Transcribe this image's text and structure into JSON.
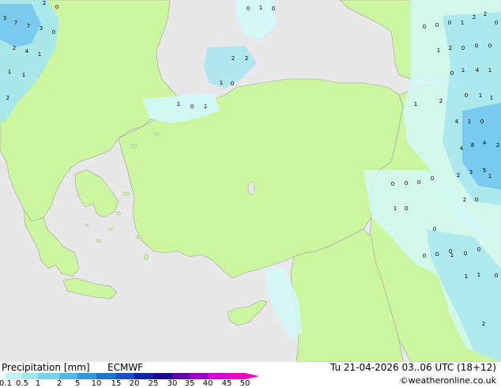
{
  "footer": {
    "title": "Precipitation [mm]",
    "model": "ECMWF",
    "valid_time": "Tu 21-04-2026 03..06 UTC (18+12)",
    "credit": "©weatheronline.co.uk"
  },
  "legend": {
    "ticks": [
      "0.1",
      "0.5",
      "1",
      "2",
      "5",
      "10",
      "15",
      "20",
      "25",
      "30",
      "35",
      "40",
      "45",
      "50"
    ],
    "colors": [
      "#e8fbfb",
      "#c4f4f4",
      "#a0e8ee",
      "#78d4ea",
      "#4fb8e4",
      "#2f98dc",
      "#1f72d0",
      "#1a4cc4",
      "#0f22a8",
      "#1a0a90",
      "#5a00b0",
      "#9a00c8",
      "#d800d8",
      "#f000c0"
    ]
  },
  "map_colors": {
    "sea": "#e8e8e8",
    "land": "#ccf5a0",
    "border": "#a0a0a0",
    "precip_light": "#d2f8f8",
    "precip_mid": "#a6e6f0",
    "precip_heavy": "#6ec4ee"
  },
  "precip_labels": [
    {
      "text": "3"
    },
    {
      "text": "7"
    },
    {
      "text": "7"
    },
    {
      "text": "3"
    },
    {
      "text": "0"
    },
    {
      "text": "2"
    },
    {
      "text": "0"
    },
    {
      "text": "2"
    },
    {
      "text": "4"
    },
    {
      "text": "1"
    },
    {
      "text": "1"
    },
    {
      "text": "1"
    },
    {
      "text": "2"
    },
    {
      "text": "0"
    },
    {
      "text": "1"
    },
    {
      "text": "0"
    },
    {
      "text": "2"
    },
    {
      "text": "2"
    },
    {
      "text": "1"
    },
    {
      "text": "0"
    },
    {
      "text": "1"
    },
    {
      "text": "0"
    },
    {
      "text": "1"
    },
    {
      "text": "0"
    },
    {
      "text": "0"
    },
    {
      "text": "0"
    },
    {
      "text": "1"
    },
    {
      "text": "2"
    },
    {
      "text": "2"
    },
    {
      "text": "0"
    },
    {
      "text": "1"
    },
    {
      "text": "2"
    },
    {
      "text": "0"
    },
    {
      "text": "0"
    },
    {
      "text": "0"
    },
    {
      "text": "4"
    },
    {
      "text": "1"
    },
    {
      "text": "1"
    },
    {
      "text": "0"
    },
    {
      "text": "0"
    },
    {
      "text": "1"
    },
    {
      "text": "2"
    },
    {
      "text": "1"
    },
    {
      "text": "1"
    },
    {
      "text": "4"
    },
    {
      "text": "1"
    },
    {
      "text": "0"
    },
    {
      "text": "4"
    },
    {
      "text": "8"
    },
    {
      "text": "4"
    },
    {
      "text": "2"
    },
    {
      "text": "3"
    },
    {
      "text": "5"
    },
    {
      "text": "2"
    },
    {
      "text": "1"
    },
    {
      "text": "0"
    },
    {
      "text": "2"
    },
    {
      "text": "0"
    },
    {
      "text": "0"
    },
    {
      "text": "0"
    },
    {
      "text": "0"
    },
    {
      "text": "1"
    },
    {
      "text": "0"
    },
    {
      "text": "0"
    },
    {
      "text": "0"
    },
    {
      "text": "0"
    },
    {
      "text": "0"
    },
    {
      "text": "1"
    },
    {
      "text": "0"
    },
    {
      "text": "0"
    },
    {
      "text": "1"
    },
    {
      "text": "1"
    },
    {
      "text": "0"
    },
    {
      "text": "2"
    }
  ]
}
